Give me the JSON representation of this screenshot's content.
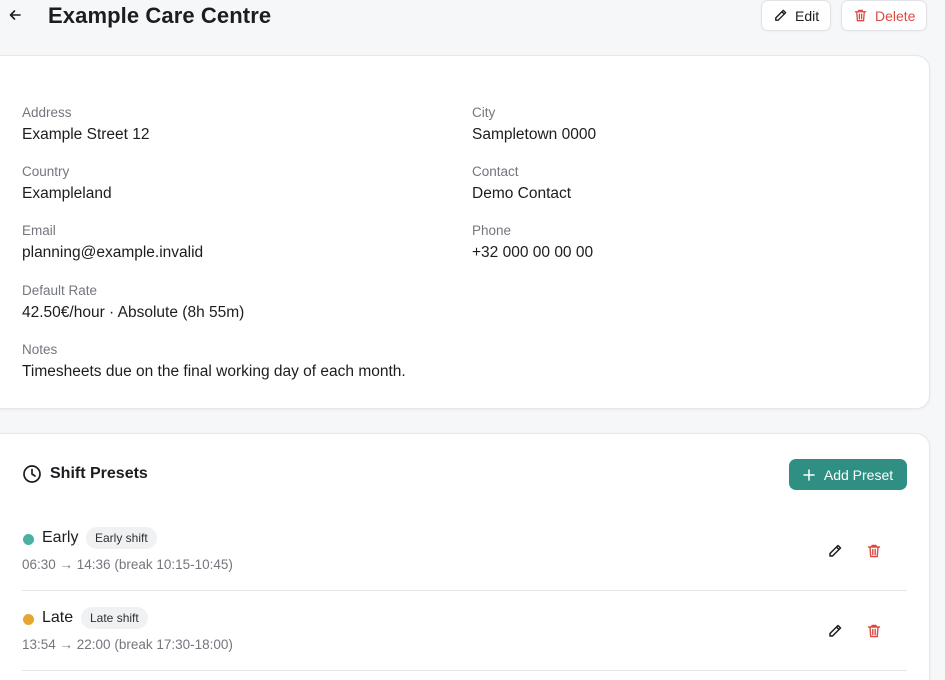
{
  "header": {
    "title": "Example Care Centre",
    "edit_label": "Edit",
    "delete_label": "Delete"
  },
  "details": {
    "address_label": "Address",
    "address": "Example Street 12",
    "city_label": "City",
    "city": "Sampletown 0000",
    "country_label": "Country",
    "country": "Exampleland",
    "contact_label": "Contact",
    "contact": "Demo Contact",
    "email_label": "Email",
    "email": "planning@example.invalid",
    "phone_label": "Phone",
    "phone": "+32 000 00 00 00",
    "rate_label": "Default Rate",
    "rate": "42.50€/hour · Absolute (8h 55m)",
    "notes_label": "Notes",
    "notes": "Timesheets due on the final working day of each month."
  },
  "presets": {
    "title": "Shift Presets",
    "add_label": "Add Preset",
    "items": [
      {
        "name": "Early",
        "tag": "Early shift",
        "times": "06:30 → 14:36  (break 10:15-10:45)",
        "color": "#4bb0a2"
      },
      {
        "name": "Late",
        "tag": "Late shift",
        "times": "13:54 → 22:00  (break 17:30-18:00)",
        "color": "#e6a634"
      }
    ]
  },
  "icons": {
    "back": "arrow-left-icon",
    "edit": "pencil-icon",
    "delete": "trash-icon",
    "clock": "clock-icon",
    "add": "plus-icon"
  },
  "colors": {
    "accent": "#2f8f82",
    "danger": "#dc4a3f",
    "early": "#4bb0a2",
    "late": "#e6a634"
  }
}
